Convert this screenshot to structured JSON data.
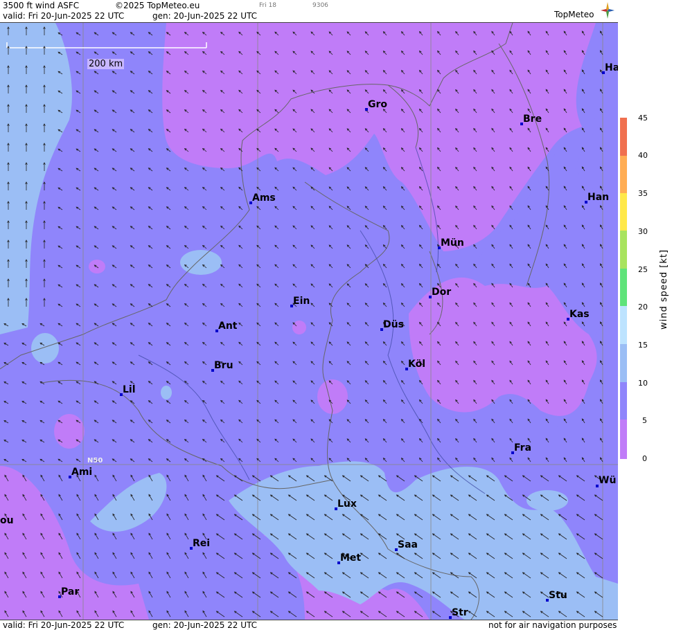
{
  "header": {
    "title": "3500 ft wind ASFC",
    "copyright": "©2025 TopMeteo.eu",
    "valid": "valid:  Fri  20-Jun-2025  22 UTC",
    "gen": "gen: 20-Jun-2025 22 UTC",
    "small_day": "Fri 18",
    "small_code": "9306",
    "logo": "TopMeteo"
  },
  "footer": {
    "valid": "valid:  Fri  20-Jun-2025  22 UTC",
    "gen": "gen: 20-Jun-2025 22 UTC",
    "disclaimer": "not for air navigation purposes"
  },
  "scale_bar": {
    "label": "200 km"
  },
  "grid_label": "N50",
  "legend": {
    "unit_label": "wind  speed  [kt]",
    "ticks": [
      "45",
      "40",
      "35",
      "30",
      "25",
      "20",
      "15",
      "10",
      "5",
      "0"
    ],
    "colors": {
      "0": "#c07cf8",
      "5": "#8f85fb",
      "10": "#9bbef5",
      "15": "#bde3ff",
      "20": "#5fe37a",
      "30": "#a8e35f",
      "35": "#ffe84a",
      "40": "#ffad55",
      "45": "#f07050"
    }
  },
  "cities": [
    {
      "name": "Gro",
      "key": "gro"
    },
    {
      "name": "Bre",
      "key": "bre"
    },
    {
      "name": "Ha",
      "key": "ham"
    },
    {
      "name": "Ams",
      "key": "ams"
    },
    {
      "name": "Han",
      "key": "han"
    },
    {
      "name": "Mün",
      "key": "mun"
    },
    {
      "name": "Ein",
      "key": "ein"
    },
    {
      "name": "Dor",
      "key": "dor"
    },
    {
      "name": "Kas",
      "key": "kas"
    },
    {
      "name": "Ant",
      "key": "ant"
    },
    {
      "name": "Düs",
      "key": "dus"
    },
    {
      "name": "Bru",
      "key": "bru"
    },
    {
      "name": "Köl",
      "key": "kol"
    },
    {
      "name": "Lil",
      "key": "lil"
    },
    {
      "name": "Fra",
      "key": "fra"
    },
    {
      "name": "Ami",
      "key": "ami"
    },
    {
      "name": "Wü",
      "key": "wur"
    },
    {
      "name": "Lux",
      "key": "lux"
    },
    {
      "name": "ou",
      "key": "rou"
    },
    {
      "name": "Rei",
      "key": "rei"
    },
    {
      "name": "Saa",
      "key": "saa"
    },
    {
      "name": "Met",
      "key": "met"
    },
    {
      "name": "Par",
      "key": "par"
    },
    {
      "name": "Stu",
      "key": "stu"
    },
    {
      "name": "Str",
      "key": "str"
    }
  ]
}
